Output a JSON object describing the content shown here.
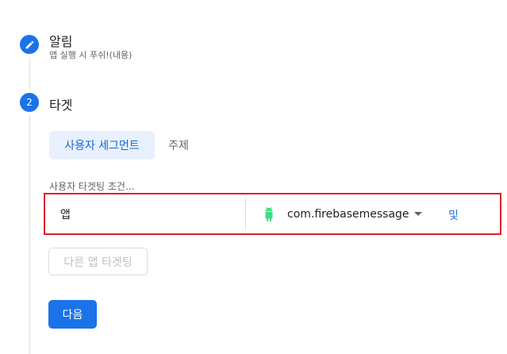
{
  "steps": [
    {
      "title": "알림",
      "subtitle": "앱 실행 시 푸쉬!(내용)",
      "icon": "pencil-icon"
    },
    {
      "number": "2",
      "title": "타겟"
    }
  ],
  "targeting": {
    "segments": {
      "selected": "사용자 세그먼트",
      "other": "주제"
    },
    "condition_label": "사용자 타겟팅 조건...",
    "app_field": "앱",
    "package_name": "com.firebasemessage",
    "and_label": "및",
    "other_app_button": "다른 앱 타겟팅",
    "next_button": "다음"
  },
  "colors": {
    "primary": "#1a73e8",
    "highlight": "#e01e2c",
    "android": "#3ddc84"
  }
}
